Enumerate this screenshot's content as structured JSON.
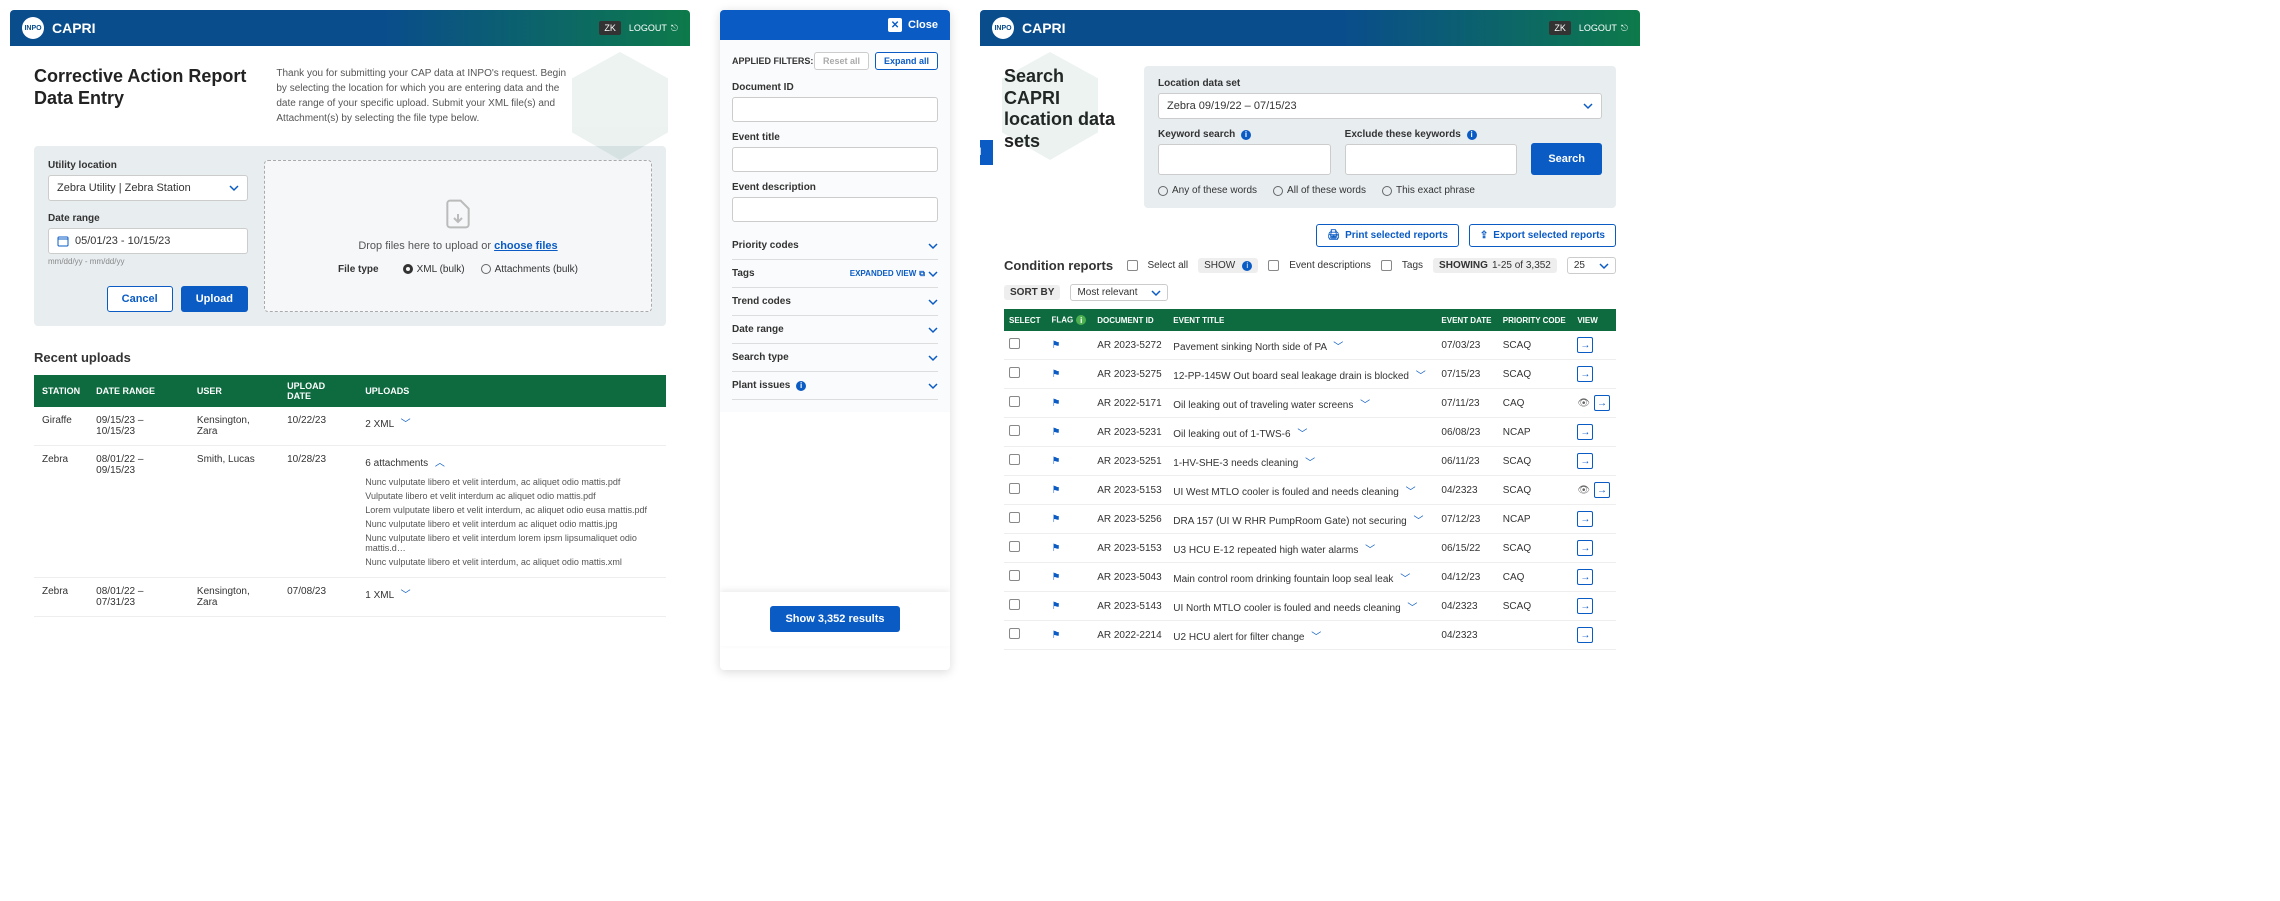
{
  "app": {
    "name": "CAPRI",
    "logo": "INPO",
    "user_initials": "ZK",
    "logout": "LOGOUT"
  },
  "left": {
    "title_l1": "Corrective Action Report",
    "title_l2": "Data Entry",
    "intro": "Thank you for submitting your CAP data at INPO's request. Begin by selecting the location for which you are entering data and the date range of your specific upload. Submit your XML file(s) and Attachment(s) by selecting the file type below.",
    "utility_label": "Utility location",
    "utility_value": "Zebra Utility | Zebra Station",
    "date_label": "Date range",
    "date_value": "05/01/23 - 10/15/23",
    "date_hint": "mm/dd/yy - mm/dd/yy",
    "cancel": "Cancel",
    "upload": "Upload",
    "drop_text": "Drop files here to upload or ",
    "choose_files": "choose files",
    "file_type_label": "File type",
    "radio_xml": "XML (bulk)",
    "radio_att": "Attachments (bulk)",
    "recent_title": "Recent uploads",
    "cols": {
      "station": "STATION",
      "range": "DATE RANGE",
      "user": "USER",
      "updated": "UPLOAD DATE",
      "uploads": "UPLOADS"
    },
    "rows": [
      {
        "station": "Giraffe",
        "range": "09/15/23 – 10/15/23",
        "user": "Kensington, Zara",
        "date": "10/22/23",
        "uploads": "2 XML",
        "expanded": false
      },
      {
        "station": "Zebra",
        "range": "08/01/22 – 09/15/23",
        "user": "Smith, Lucas",
        "date": "10/28/23",
        "uploads": "6 attachments",
        "expanded": true,
        "files": [
          "Nunc vulputate libero et velit interdum, ac aliquet odio mattis.pdf",
          "Vulputate libero et velit interdum ac aliquet odio mattis.pdf",
          "Lorem vulputate libero et velit interdum, ac aliquet odio eusa mattis.pdf",
          "Nunc vulputate libero et velit interdum ac aliquet odio mattis.jpg",
          "Nunc vulputate libero et velit interdum lorem ipsm lipsumaliquet odio mattis.d…",
          "Nunc vulputate libero et velit interdum, ac aliquet odio mattis.xml"
        ]
      },
      {
        "station": "Zebra",
        "range": "08/01/22 – 07/31/23",
        "user": "Kensington, Zara",
        "date": "07/08/23",
        "uploads": "1 XML",
        "expanded": false
      }
    ]
  },
  "filter": {
    "close": "Close",
    "applied": "APPLIED FILTERS:",
    "reset": "Reset all",
    "expand": "Expand all",
    "doc_id": "Document ID",
    "event_title": "Event title",
    "event_desc": "Event description",
    "priority": "Priority codes",
    "tags": "Tags",
    "expanded_view": "EXPANDED VIEW",
    "trend": "Trend codes",
    "daterange": "Date range",
    "searchtype": "Search type",
    "plant": "Plant issues",
    "show_results": "Show 3,352 results"
  },
  "right": {
    "title_l1": "Search CAPRI",
    "title_l2": "location data sets",
    "expand_panel": "Expand filter panel",
    "loc_label": "Location data set",
    "loc_value": "Zebra 09/19/22 – 07/15/23",
    "kw_label": "Keyword search",
    "ex_label": "Exclude these keywords",
    "search_btn": "Search",
    "r_any": "Any of these words",
    "r_all": "All of these words",
    "r_exact": "This exact phrase",
    "print": "Print selected reports",
    "export": "Export selected reports",
    "cond_title": "Condition reports",
    "select_all": "Select all",
    "show_label": "SHOW",
    "event_desc_chk": "Event descriptions",
    "tags_chk": "Tags",
    "showing_label": "SHOWING",
    "showing_value": "1-25 of 3,352",
    "per_page": "25",
    "sort_label": "SORT BY",
    "sort_value": "Most relevant",
    "cols": {
      "select": "SELECT",
      "flag": "FLAG",
      "doc": "DOCUMENT ID",
      "title": "EVENT TITLE",
      "date": "EVENT DATE",
      "priority": "PRIORITY CODE",
      "view": "VIEW"
    },
    "rows": [
      {
        "doc": "AR 2023-5272",
        "title": "Pavement sinking North side of PA",
        "date": "07/03/23",
        "pc": "SCAQ",
        "eye": false
      },
      {
        "doc": "AR 2023-5275",
        "title": "12-PP-145W Out board seal leakage drain is blocked",
        "date": "07/15/23",
        "pc": "SCAQ",
        "eye": false
      },
      {
        "doc": "AR 2022-5171",
        "title": "Oil leaking out of traveling water screens",
        "date": "07/11/23",
        "pc": "CAQ",
        "eye": true
      },
      {
        "doc": "AR 2023-5231",
        "title": "Oil leaking out of 1-TWS-6",
        "date": "06/08/23",
        "pc": "NCAP",
        "eye": false
      },
      {
        "doc": "AR 2023-5251",
        "title": "1-HV-SHE-3 needs cleaning",
        "date": "06/11/23",
        "pc": "SCAQ",
        "eye": false
      },
      {
        "doc": "AR 2023-5153",
        "title": "UI West MTLO cooler is fouled and needs cleaning",
        "date": "04/2323",
        "pc": "SCAQ",
        "eye": true
      },
      {
        "doc": "AR 2023-5256",
        "title": "DRA 157 (UI W RHR PumpRoom Gate) not securing",
        "date": "07/12/23",
        "pc": "NCAP",
        "eye": false
      },
      {
        "doc": "AR 2023-5153",
        "title": "U3 HCU E-12 repeated high water alarms",
        "date": "06/15/22",
        "pc": "SCAQ",
        "eye": false
      },
      {
        "doc": "AR 2023-5043",
        "title": "Main control room drinking fountain loop seal leak",
        "date": "04/12/23",
        "pc": "CAQ",
        "eye": false
      },
      {
        "doc": "AR 2023-5143",
        "title": "UI North MTLO cooler is fouled and needs cleaning",
        "date": "04/2323",
        "pc": "SCAQ",
        "eye": false
      },
      {
        "doc": "AR 2022-2214",
        "title": "U2 HCU alert for filter change",
        "date": "04/2323",
        "pc": "",
        "eye": false
      }
    ]
  }
}
